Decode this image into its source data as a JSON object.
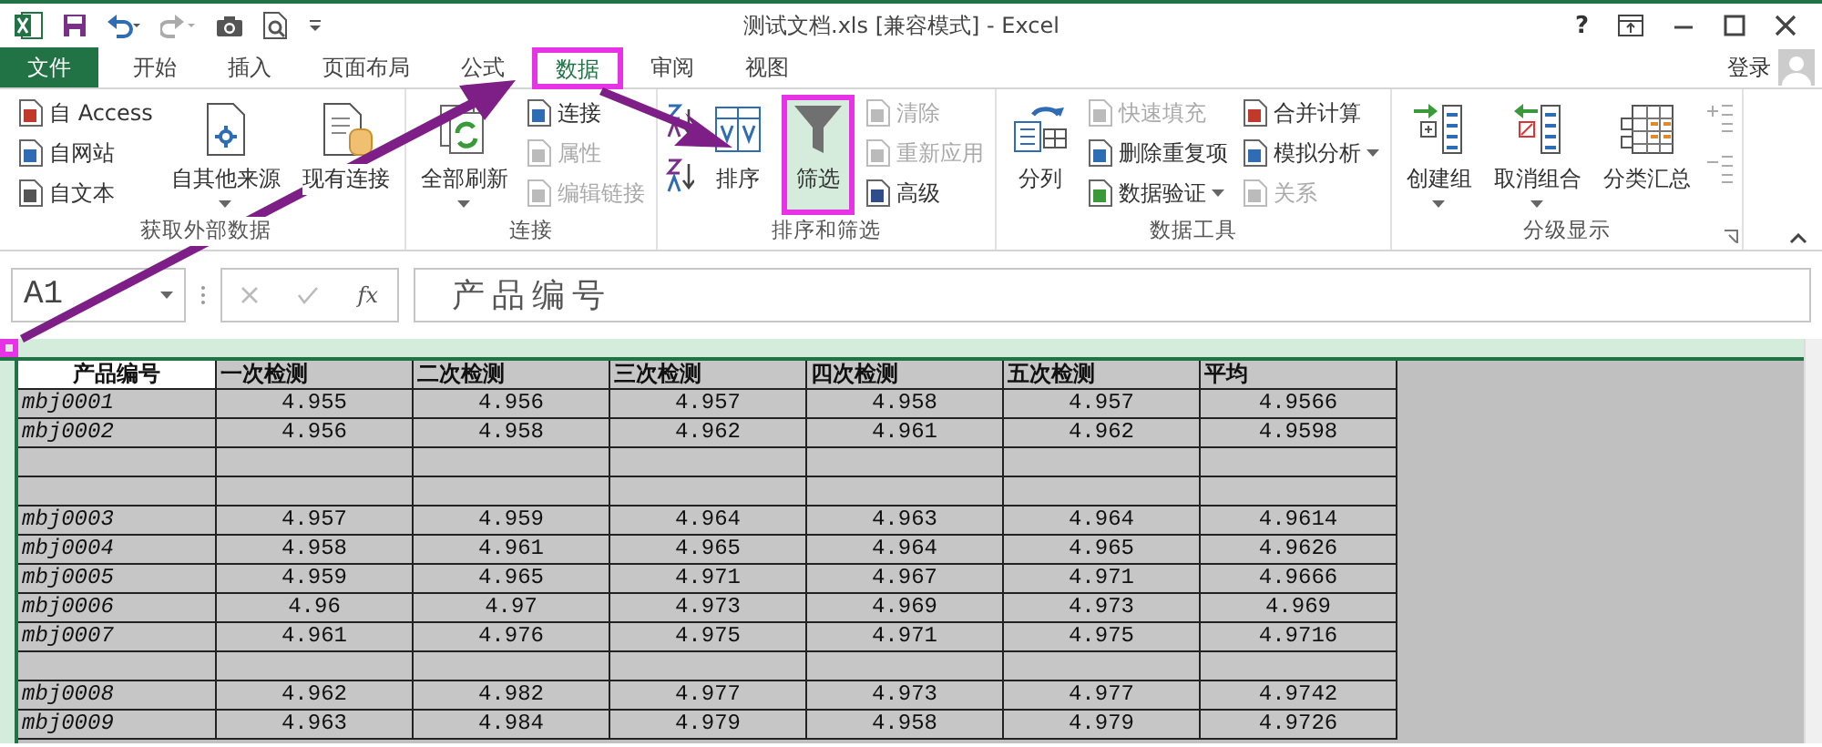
{
  "title_bar": {
    "title": "测试文档.xls  [兼容模式] - Excel",
    "help": "?"
  },
  "tabs": [
    {
      "label": "文件",
      "kind": "file",
      "selected": false,
      "highlighted": false
    },
    {
      "label": "开始",
      "kind": "tab",
      "selected": false,
      "highlighted": false
    },
    {
      "label": "插入",
      "kind": "tab",
      "selected": false,
      "highlighted": false
    },
    {
      "label": "页面布局",
      "kind": "tab",
      "selected": false,
      "highlighted": false
    },
    {
      "label": "公式",
      "kind": "tab",
      "selected": false,
      "highlighted": false
    },
    {
      "label": "数据",
      "kind": "tab",
      "selected": true,
      "highlighted": true
    },
    {
      "label": "审阅",
      "kind": "tab",
      "selected": false,
      "highlighted": false
    },
    {
      "label": "视图",
      "kind": "tab",
      "selected": false,
      "highlighted": false
    }
  ],
  "sign_in": "登录",
  "ribbon_groups": [
    {
      "label": "获取外部数据",
      "columns": [
        {
          "kind": "stack",
          "items": [
            {
              "label": "自 Access",
              "disabled": false,
              "dropdown": false
            },
            {
              "label": "自网站",
              "disabled": false,
              "dropdown": false
            },
            {
              "label": "自文本",
              "disabled": false,
              "dropdown": false
            }
          ]
        },
        {
          "kind": "large",
          "label": "自其他来源",
          "dropdown": true,
          "highlighted": false
        },
        {
          "kind": "large",
          "label": "现有连接",
          "dropdown": false,
          "highlighted": false
        }
      ]
    },
    {
      "label": "连接",
      "columns": [
        {
          "kind": "large",
          "label": "全部刷新",
          "dropdown": true,
          "highlighted": false
        },
        {
          "kind": "stack",
          "items": [
            {
              "label": "连接",
              "disabled": false,
              "dropdown": false
            },
            {
              "label": "属性",
              "disabled": true,
              "dropdown": false
            },
            {
              "label": "编辑链接",
              "disabled": true,
              "dropdown": false
            }
          ]
        }
      ]
    },
    {
      "label": "排序和筛选",
      "columns": [
        {
          "kind": "sorticons"
        },
        {
          "kind": "large",
          "label": "排序",
          "dropdown": false,
          "highlighted": false
        },
        {
          "kind": "large",
          "label": "筛选",
          "dropdown": false,
          "highlighted": true
        },
        {
          "kind": "stack",
          "items": [
            {
              "label": "清除",
              "disabled": true,
              "dropdown": false
            },
            {
              "label": "重新应用",
              "disabled": true,
              "dropdown": false
            },
            {
              "label": "高级",
              "disabled": false,
              "dropdown": false
            }
          ]
        }
      ]
    },
    {
      "label": "数据工具",
      "columns": [
        {
          "kind": "large",
          "label": "分列",
          "dropdown": false,
          "highlighted": false
        },
        {
          "kind": "stack",
          "items": [
            {
              "label": "快速填充",
              "disabled": true,
              "dropdown": false
            },
            {
              "label": "删除重复项",
              "disabled": false,
              "dropdown": false
            },
            {
              "label": "数据验证",
              "disabled": false,
              "dropdown": true
            }
          ]
        },
        {
          "kind": "stack",
          "items": [
            {
              "label": "合并计算",
              "disabled": false,
              "dropdown": false
            },
            {
              "label": "模拟分析",
              "disabled": false,
              "dropdown": true
            },
            {
              "label": "关系",
              "disabled": true,
              "dropdown": false
            }
          ]
        }
      ]
    },
    {
      "label": "分级显示",
      "launcher": true,
      "columns": [
        {
          "kind": "large",
          "label": "创建组",
          "dropdown": true,
          "highlighted": false
        },
        {
          "kind": "large",
          "label": "取消组合",
          "dropdown": true,
          "highlighted": false
        },
        {
          "kind": "large",
          "label": "分类汇总",
          "dropdown": false,
          "highlighted": false
        },
        {
          "kind": "outlineicons"
        }
      ]
    }
  ],
  "formula_bar": {
    "name_box": "A1",
    "fx": "fx",
    "formula": "产品编号"
  },
  "sheet": {
    "select_all_highlighted": true,
    "rows": [
      {
        "kind": "header",
        "cells": [
          "产品编号",
          "一次检测",
          "二次检测",
          "三次检测",
          "四次检测",
          "五次检测",
          "平均"
        ]
      },
      {
        "kind": "data",
        "cells": [
          "mbj0001",
          "4.955",
          "4.956",
          "4.957",
          "4.958",
          "4.957",
          "4.9566"
        ]
      },
      {
        "kind": "data",
        "cells": [
          "mbj0002",
          "4.956",
          "4.958",
          "4.962",
          "4.961",
          "4.962",
          "4.9598"
        ]
      },
      {
        "kind": "blank"
      },
      {
        "kind": "blank"
      },
      {
        "kind": "data",
        "cells": [
          "mbj0003",
          "4.957",
          "4.959",
          "4.964",
          "4.963",
          "4.964",
          "4.9614"
        ]
      },
      {
        "kind": "data",
        "cells": [
          "mbj0004",
          "4.958",
          "4.961",
          "4.965",
          "4.964",
          "4.965",
          "4.9626"
        ]
      },
      {
        "kind": "data",
        "cells": [
          "mbj0005",
          "4.959",
          "4.965",
          "4.971",
          "4.967",
          "4.971",
          "4.9666"
        ]
      },
      {
        "kind": "data",
        "cells": [
          "mbj0006",
          "4.96",
          "4.97",
          "4.973",
          "4.969",
          "4.973",
          "4.969"
        ]
      },
      {
        "kind": "data",
        "cells": [
          "mbj0007",
          "4.961",
          "4.976",
          "4.975",
          "4.971",
          "4.975",
          "4.9716"
        ]
      },
      {
        "kind": "blank"
      },
      {
        "kind": "data",
        "cells": [
          "mbj0008",
          "4.962",
          "4.982",
          "4.977",
          "4.973",
          "4.977",
          "4.9742"
        ]
      },
      {
        "kind": "data",
        "cells": [
          "mbj0009",
          "4.963",
          "4.984",
          "4.979",
          "4.958",
          "4.979",
          "4.9726"
        ]
      }
    ]
  }
}
